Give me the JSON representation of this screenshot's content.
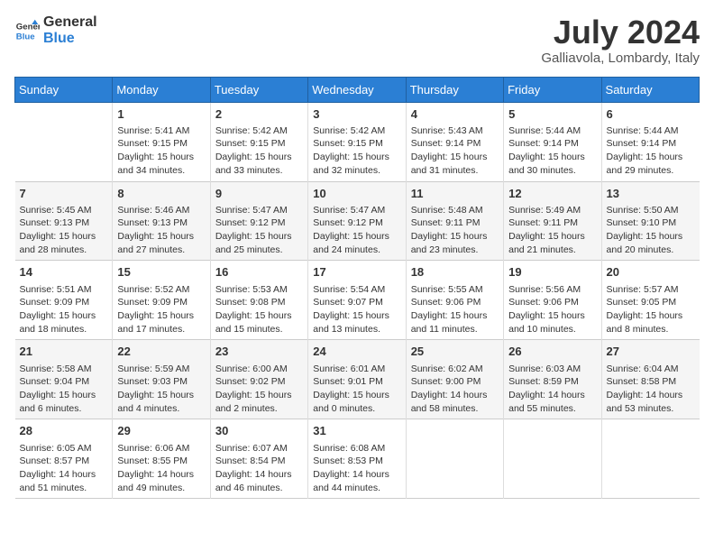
{
  "header": {
    "logo_line1": "General",
    "logo_line2": "Blue",
    "month": "July 2024",
    "location": "Galliavola, Lombardy, Italy"
  },
  "days_of_week": [
    "Sunday",
    "Monday",
    "Tuesday",
    "Wednesday",
    "Thursday",
    "Friday",
    "Saturday"
  ],
  "weeks": [
    [
      {
        "num": "",
        "info": ""
      },
      {
        "num": "1",
        "info": "Sunrise: 5:41 AM\nSunset: 9:15 PM\nDaylight: 15 hours\nand 34 minutes."
      },
      {
        "num": "2",
        "info": "Sunrise: 5:42 AM\nSunset: 9:15 PM\nDaylight: 15 hours\nand 33 minutes."
      },
      {
        "num": "3",
        "info": "Sunrise: 5:42 AM\nSunset: 9:15 PM\nDaylight: 15 hours\nand 32 minutes."
      },
      {
        "num": "4",
        "info": "Sunrise: 5:43 AM\nSunset: 9:14 PM\nDaylight: 15 hours\nand 31 minutes."
      },
      {
        "num": "5",
        "info": "Sunrise: 5:44 AM\nSunset: 9:14 PM\nDaylight: 15 hours\nand 30 minutes."
      },
      {
        "num": "6",
        "info": "Sunrise: 5:44 AM\nSunset: 9:14 PM\nDaylight: 15 hours\nand 29 minutes."
      }
    ],
    [
      {
        "num": "7",
        "info": "Sunrise: 5:45 AM\nSunset: 9:13 PM\nDaylight: 15 hours\nand 28 minutes."
      },
      {
        "num": "8",
        "info": "Sunrise: 5:46 AM\nSunset: 9:13 PM\nDaylight: 15 hours\nand 27 minutes."
      },
      {
        "num": "9",
        "info": "Sunrise: 5:47 AM\nSunset: 9:12 PM\nDaylight: 15 hours\nand 25 minutes."
      },
      {
        "num": "10",
        "info": "Sunrise: 5:47 AM\nSunset: 9:12 PM\nDaylight: 15 hours\nand 24 minutes."
      },
      {
        "num": "11",
        "info": "Sunrise: 5:48 AM\nSunset: 9:11 PM\nDaylight: 15 hours\nand 23 minutes."
      },
      {
        "num": "12",
        "info": "Sunrise: 5:49 AM\nSunset: 9:11 PM\nDaylight: 15 hours\nand 21 minutes."
      },
      {
        "num": "13",
        "info": "Sunrise: 5:50 AM\nSunset: 9:10 PM\nDaylight: 15 hours\nand 20 minutes."
      }
    ],
    [
      {
        "num": "14",
        "info": "Sunrise: 5:51 AM\nSunset: 9:09 PM\nDaylight: 15 hours\nand 18 minutes."
      },
      {
        "num": "15",
        "info": "Sunrise: 5:52 AM\nSunset: 9:09 PM\nDaylight: 15 hours\nand 17 minutes."
      },
      {
        "num": "16",
        "info": "Sunrise: 5:53 AM\nSunset: 9:08 PM\nDaylight: 15 hours\nand 15 minutes."
      },
      {
        "num": "17",
        "info": "Sunrise: 5:54 AM\nSunset: 9:07 PM\nDaylight: 15 hours\nand 13 minutes."
      },
      {
        "num": "18",
        "info": "Sunrise: 5:55 AM\nSunset: 9:06 PM\nDaylight: 15 hours\nand 11 minutes."
      },
      {
        "num": "19",
        "info": "Sunrise: 5:56 AM\nSunset: 9:06 PM\nDaylight: 15 hours\nand 10 minutes."
      },
      {
        "num": "20",
        "info": "Sunrise: 5:57 AM\nSunset: 9:05 PM\nDaylight: 15 hours\nand 8 minutes."
      }
    ],
    [
      {
        "num": "21",
        "info": "Sunrise: 5:58 AM\nSunset: 9:04 PM\nDaylight: 15 hours\nand 6 minutes."
      },
      {
        "num": "22",
        "info": "Sunrise: 5:59 AM\nSunset: 9:03 PM\nDaylight: 15 hours\nand 4 minutes."
      },
      {
        "num": "23",
        "info": "Sunrise: 6:00 AM\nSunset: 9:02 PM\nDaylight: 15 hours\nand 2 minutes."
      },
      {
        "num": "24",
        "info": "Sunrise: 6:01 AM\nSunset: 9:01 PM\nDaylight: 15 hours\nand 0 minutes."
      },
      {
        "num": "25",
        "info": "Sunrise: 6:02 AM\nSunset: 9:00 PM\nDaylight: 14 hours\nand 58 minutes."
      },
      {
        "num": "26",
        "info": "Sunrise: 6:03 AM\nSunset: 8:59 PM\nDaylight: 14 hours\nand 55 minutes."
      },
      {
        "num": "27",
        "info": "Sunrise: 6:04 AM\nSunset: 8:58 PM\nDaylight: 14 hours\nand 53 minutes."
      }
    ],
    [
      {
        "num": "28",
        "info": "Sunrise: 6:05 AM\nSunset: 8:57 PM\nDaylight: 14 hours\nand 51 minutes."
      },
      {
        "num": "29",
        "info": "Sunrise: 6:06 AM\nSunset: 8:55 PM\nDaylight: 14 hours\nand 49 minutes."
      },
      {
        "num": "30",
        "info": "Sunrise: 6:07 AM\nSunset: 8:54 PM\nDaylight: 14 hours\nand 46 minutes."
      },
      {
        "num": "31",
        "info": "Sunrise: 6:08 AM\nSunset: 8:53 PM\nDaylight: 14 hours\nand 44 minutes."
      },
      {
        "num": "",
        "info": ""
      },
      {
        "num": "",
        "info": ""
      },
      {
        "num": "",
        "info": ""
      }
    ]
  ]
}
